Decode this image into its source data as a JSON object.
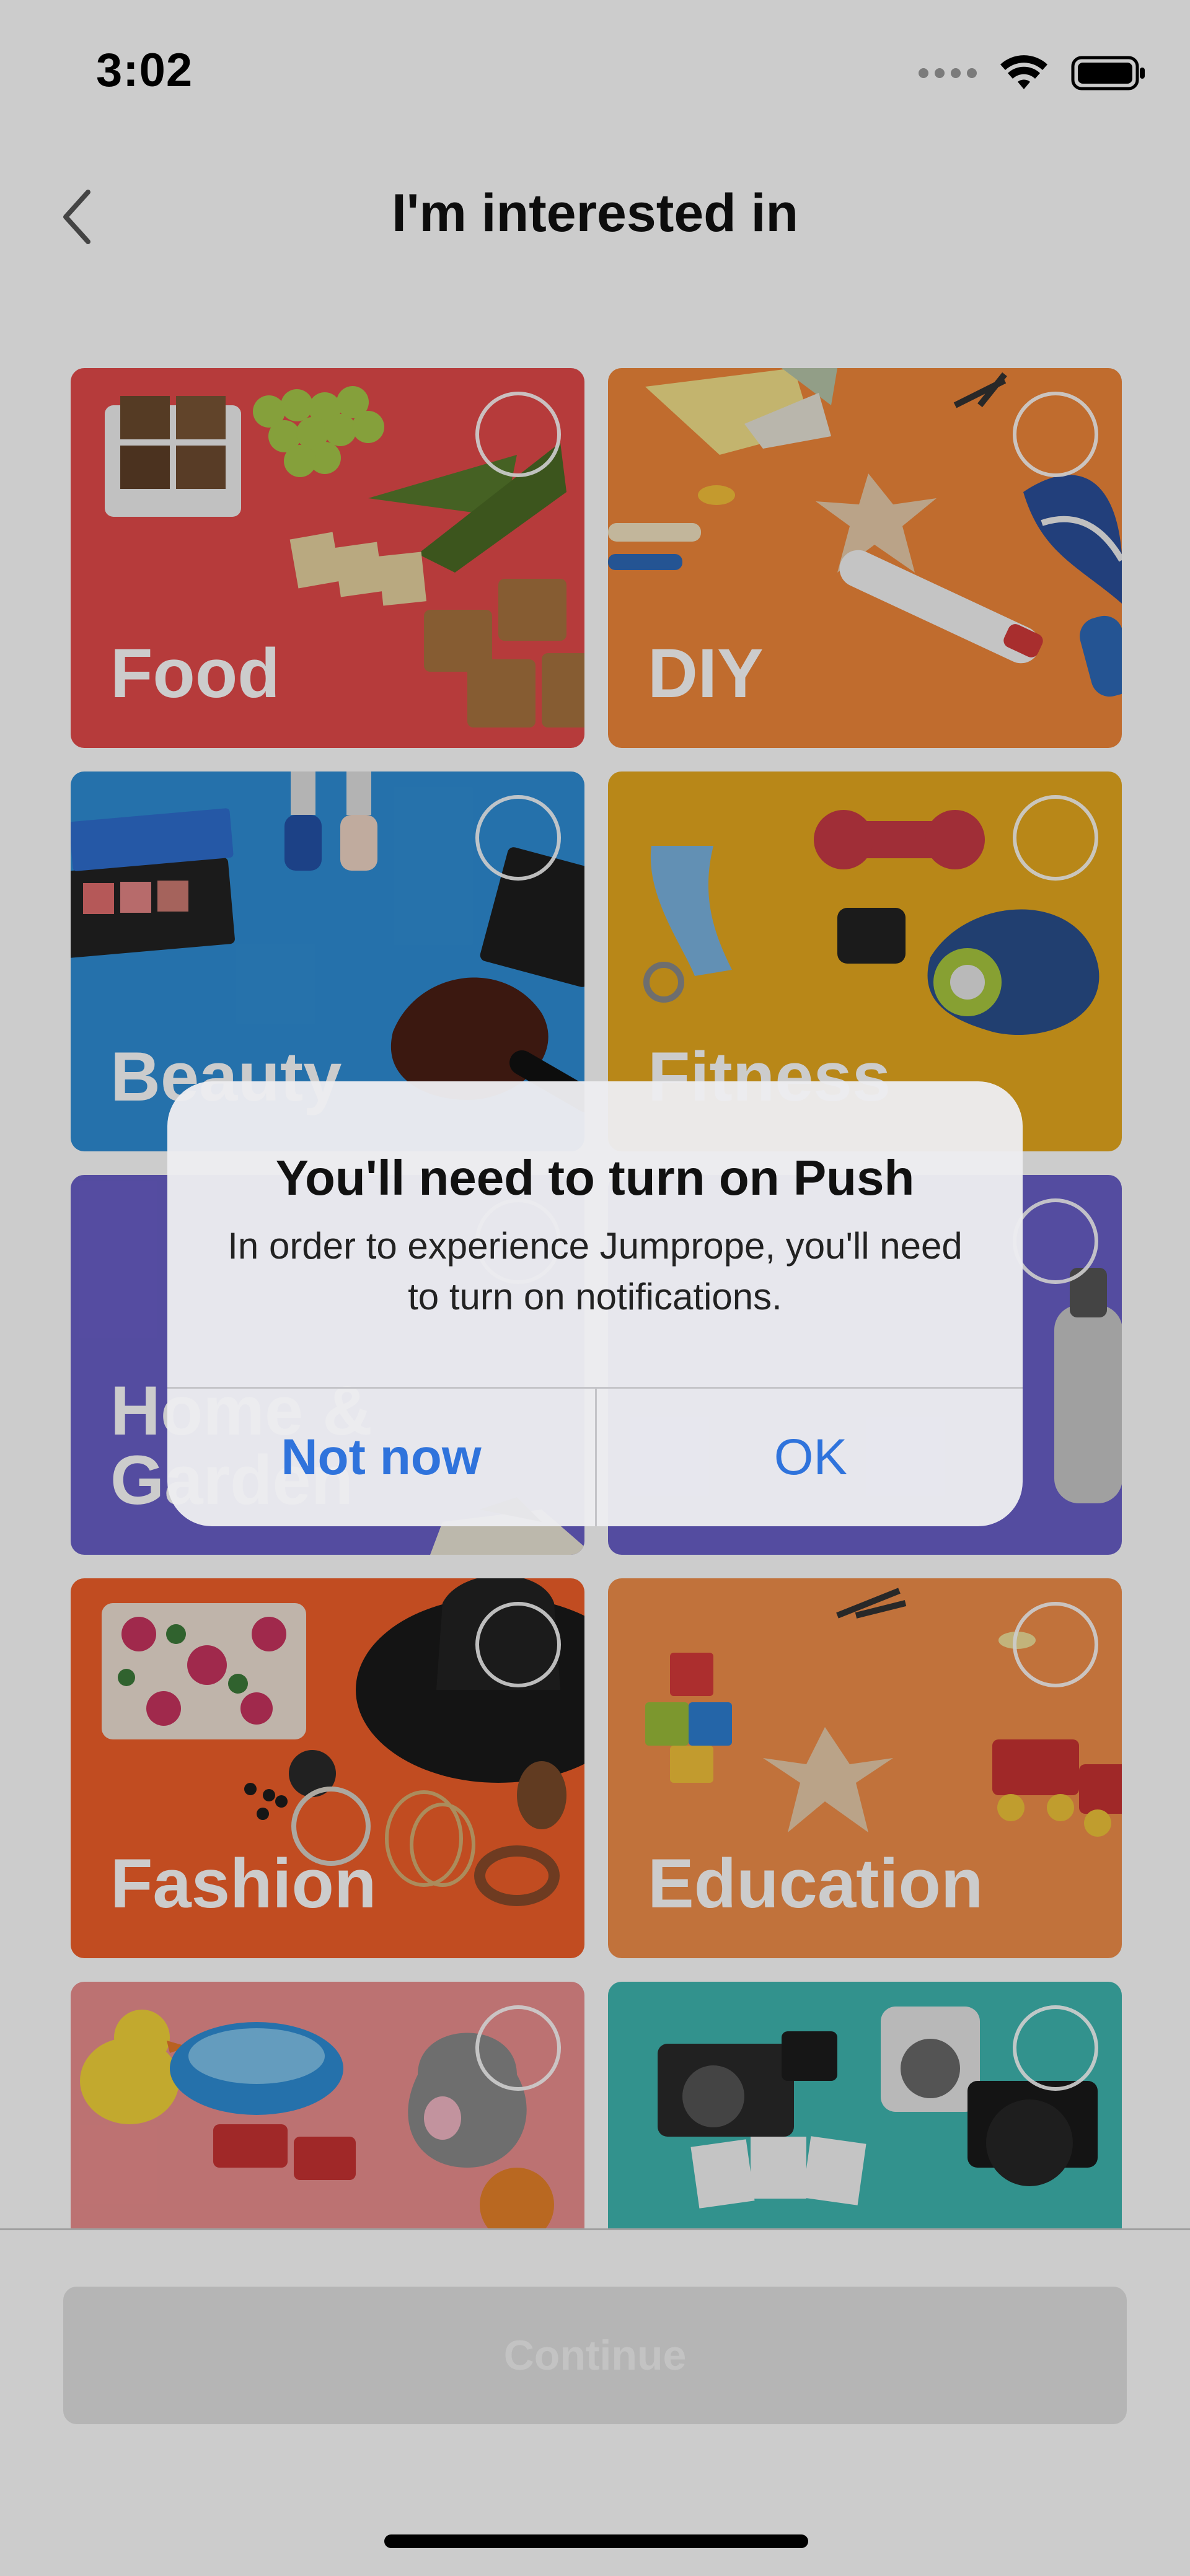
{
  "status_bar": {
    "time": "3:02"
  },
  "header": {
    "title": "I'm interested in",
    "back_icon": "chevron-left-icon"
  },
  "categories": [
    {
      "label": "Food",
      "color": "#e44a4a"
    },
    {
      "label": "DIY",
      "color": "#f0873a"
    },
    {
      "label": "Beauty",
      "color": "#2f8ed6"
    },
    {
      "label": "Fitness",
      "color": "#e6a91f"
    },
    {
      "label": "Home & Garden",
      "color": "#6a5fc9"
    },
    {
      "label": "",
      "color": "#6a5fc9"
    },
    {
      "label": "Fashion",
      "color": "#f2602a"
    },
    {
      "label": "Education",
      "color": "#f28f4a"
    },
    {
      "label": "",
      "color": "#ec8f8f"
    },
    {
      "label": "",
      "color": "#3fb7b1"
    }
  ],
  "footer": {
    "continue_label": "Continue"
  },
  "alert": {
    "title": "You'll need to turn on Push",
    "message": "In order to experience Jumprope, you'll need to turn on notifications.",
    "not_now_label": "Not now",
    "ok_label": "OK"
  },
  "colors": {
    "accent": "#2f73dc"
  }
}
